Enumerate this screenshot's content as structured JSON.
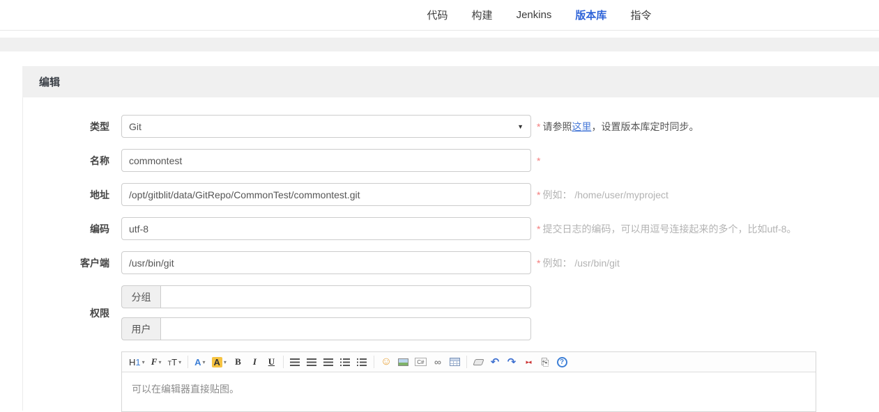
{
  "nav": {
    "items": [
      {
        "label": "代码",
        "active": false
      },
      {
        "label": "构建",
        "active": false
      },
      {
        "label": "Jenkins",
        "active": false
      },
      {
        "label": "版本库",
        "active": true
      },
      {
        "label": "指令",
        "active": false
      }
    ]
  },
  "panel": {
    "title": "编辑"
  },
  "form": {
    "required_marker": "*",
    "fields": [
      {
        "label": "类型",
        "control": "select",
        "value": "Git",
        "hint_prefix": "请参照",
        "hint_link": "这里",
        "hint_suffix": "，设置版本库定时同步。"
      },
      {
        "label": "名称",
        "control": "input",
        "value": "commontest",
        "hint": ""
      },
      {
        "label": "地址",
        "control": "input",
        "value": "/opt/gitblit/data/GitRepo/CommonTest/commontest.git",
        "hint": "例如： /home/user/myproject"
      },
      {
        "label": "编码",
        "control": "input",
        "value": "utf-8",
        "hint": "提交日志的编码，可以用逗号连接起来的多个，比如utf-8。"
      },
      {
        "label": "客户端",
        "control": "input",
        "value": "/usr/bin/git",
        "hint": "例如： /usr/bin/git"
      }
    ],
    "permissions": {
      "label": "权限",
      "group_label": "分组",
      "group_value": "",
      "user_label": "用户",
      "user_value": ""
    }
  },
  "editor": {
    "toolbar": {
      "heading_h": "H",
      "heading_n": "1",
      "font_family": "F",
      "font_size": "TT",
      "fore_color": "A",
      "back_color": "A",
      "bold": "B",
      "italic": "I",
      "underline": "U",
      "emoji_glyph": "☺",
      "code_label": "C#",
      "link_glyph": "∞",
      "undo_glyph": "↶",
      "redo_glyph": "↷",
      "shrink_glyph": "▸◂",
      "paste_glyph": "⎘",
      "help_glyph": "?",
      "caret": "▾"
    },
    "select_arrow": "▼",
    "content": "可以在编辑器直接贴图。"
  },
  "colors": {
    "accent": "#2e63d8",
    "link": "#4a7bd8",
    "required": "#f47d7d",
    "hint_gray": "#b3b3b3",
    "band_gray": "#f0f0f0"
  }
}
